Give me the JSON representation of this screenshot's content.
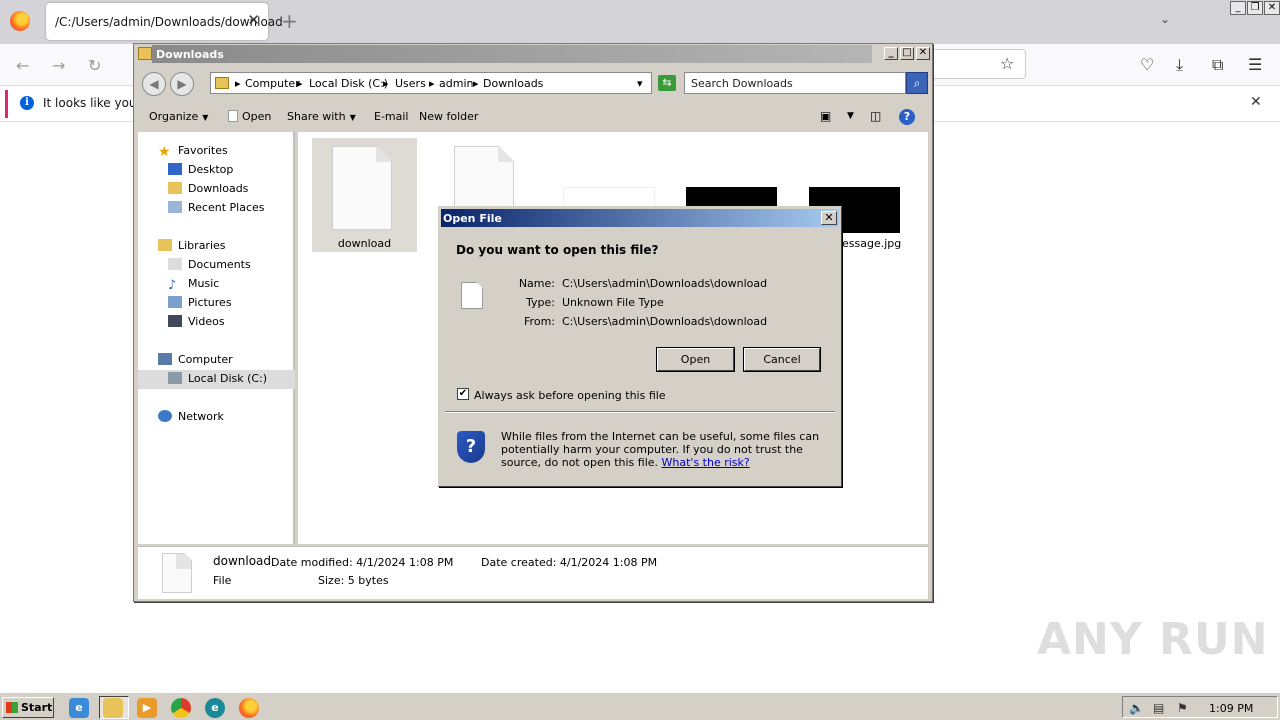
{
  "browser": {
    "tab_title": "/C:/Users/admin/Downloads/download",
    "tab_close": "✕",
    "new_tab": "+",
    "notice_text": "It looks like you ha",
    "notice_close": "✕"
  },
  "explorer": {
    "title": "Downloads",
    "breadcrumb": [
      "Computer",
      "Local Disk (C:)",
      "Users",
      "admin",
      "Downloads"
    ],
    "search_placeholder": "Search Downloads",
    "toolbar": {
      "organize": "Organize",
      "open": "Open",
      "share_with": "Share with",
      "email": "E-mail",
      "new_folder": "New folder"
    },
    "nav": {
      "favorites": "Favorites",
      "desktop": "Desktop",
      "downloads": "Downloads",
      "recent_places": "Recent Places",
      "libraries": "Libraries",
      "documents": "Documents",
      "music": "Music",
      "pictures": "Pictures",
      "videos": "Videos",
      "computer": "Computer",
      "local_disk": "Local Disk (C:)",
      "network": "Network"
    },
    "files": {
      "download": "download",
      "message_partial": "essage.jpg"
    },
    "details": {
      "name": "download",
      "type": "File",
      "date_modified": "Date modified: 4/1/2024 1:08 PM",
      "date_created": "Date created: 4/1/2024 1:08 PM",
      "size": "Size: 5 bytes"
    }
  },
  "dialog": {
    "title": "Open File",
    "close": "✕",
    "question": "Do you want to open this file?",
    "name_label": "Name:",
    "name_value": "C:\\Users\\admin\\Downloads\\download",
    "type_label": "Type:",
    "type_value": "Unknown File Type",
    "from_label": "From:",
    "from_value": "C:\\Users\\admin\\Downloads\\download",
    "open_button": "Open",
    "cancel_button": "Cancel",
    "always_ask_label": "Always ask before opening this file",
    "always_ask_checked": true,
    "warning_text": "While files from the Internet can be useful, some files can potentially harm your computer. If you do not trust the source, do not open this file.",
    "risk_link": "What's the risk?"
  },
  "watermark": "ANY RUN",
  "taskbar": {
    "start_label": "Start",
    "clock": "1:09 PM"
  }
}
